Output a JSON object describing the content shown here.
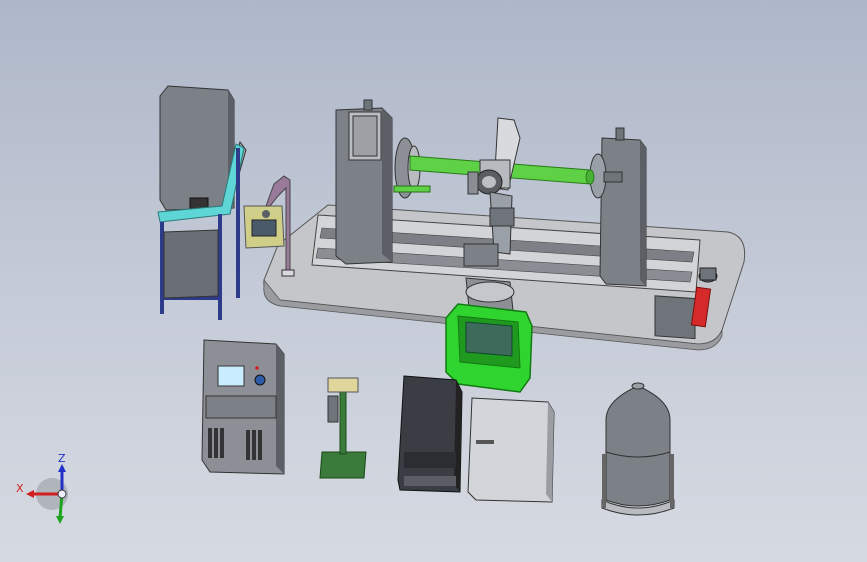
{
  "triad": {
    "x_label": "X",
    "z_label": "Z",
    "x_color": "#d11f1f",
    "y_color": "#1fa31f",
    "z_color": "#2330c8"
  },
  "colors": {
    "viewport_top": "#aeb7c9",
    "viewport_bottom": "#d6dae2",
    "steel": "#6f747b",
    "steel_light": "#9aa0a7",
    "rail": "#c9ccd1",
    "workpiece": "#5fd146",
    "positioner_base": "#2fd42f",
    "accent_cyan": "#5fd6d6",
    "pendant_body": "#cfcf8a",
    "torch_red": "#d42a2a",
    "stand_green": "#3a7a3a"
  }
}
